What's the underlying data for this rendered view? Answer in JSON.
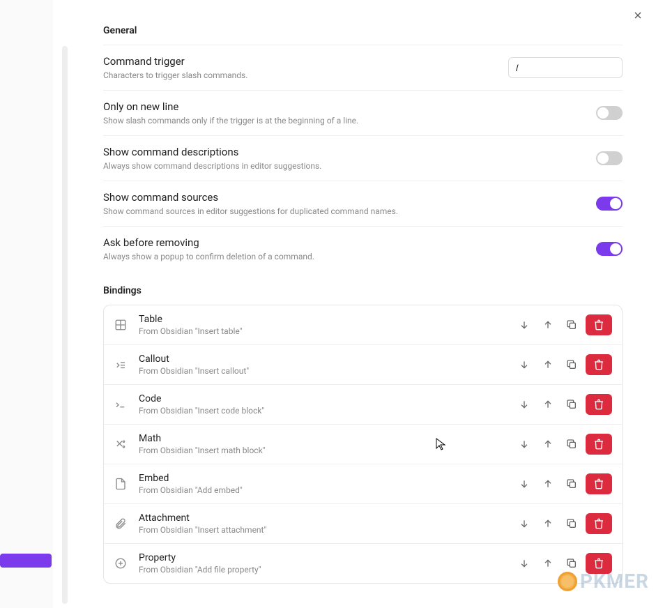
{
  "sections": {
    "general": "General",
    "bindings": "Bindings"
  },
  "settings": {
    "commandTrigger": {
      "label": "Command trigger",
      "desc": "Characters to trigger slash commands.",
      "value": "/"
    },
    "onlyNewLine": {
      "label": "Only on new line",
      "desc": "Show slash commands only if the trigger is at the beginning of a line.",
      "enabled": false
    },
    "showDescriptions": {
      "label": "Show command descriptions",
      "desc": "Always show command descriptions in editor suggestions.",
      "enabled": false
    },
    "showSources": {
      "label": "Show command sources",
      "desc": "Show command sources in editor suggestions for duplicated command names.",
      "enabled": true
    },
    "askBeforeRemoving": {
      "label": "Ask before removing",
      "desc": "Always show a popup to confirm deletion of a command.",
      "enabled": true
    }
  },
  "bindings": [
    {
      "name": "Table",
      "from": "From Obsidian \"Insert table\"",
      "icon": "table"
    },
    {
      "name": "Callout",
      "from": "From Obsidian \"Insert callout\"",
      "icon": "callout"
    },
    {
      "name": "Code",
      "from": "From Obsidian \"Insert code block\"",
      "icon": "code"
    },
    {
      "name": "Math",
      "from": "From Obsidian \"Insert math block\"",
      "icon": "math"
    },
    {
      "name": "Embed",
      "from": "From Obsidian \"Add embed\"",
      "icon": "file"
    },
    {
      "name": "Attachment",
      "from": "From Obsidian \"Insert attachment\"",
      "icon": "clip"
    },
    {
      "name": "Property",
      "from": "From Obsidian \"Add file property\"",
      "icon": "plus"
    }
  ],
  "watermark": "PKMER"
}
